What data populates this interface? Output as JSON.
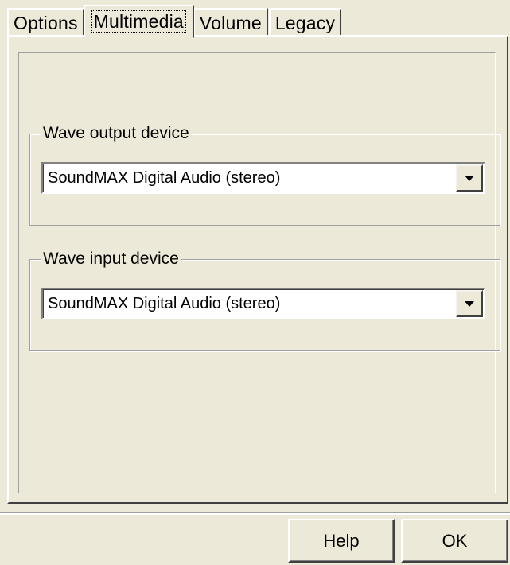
{
  "tabs": [
    {
      "label": "Options",
      "selected": false
    },
    {
      "label": "Multimedia",
      "selected": true
    },
    {
      "label": "Volume",
      "selected": false
    },
    {
      "label": "Legacy",
      "selected": false
    }
  ],
  "wave_output": {
    "legend": "Wave output device",
    "value": "SoundMAX Digital Audio (stereo)"
  },
  "wave_input": {
    "legend": "Wave input device",
    "value": "SoundMAX Digital Audio (stereo)"
  },
  "buttons": {
    "help_label": "Help",
    "ok_label": "OK"
  },
  "colors": {
    "face": "#ece9d8",
    "highlight": "#ffffff",
    "shadow": "#a0a0a0",
    "dark_shadow": "#404040"
  }
}
